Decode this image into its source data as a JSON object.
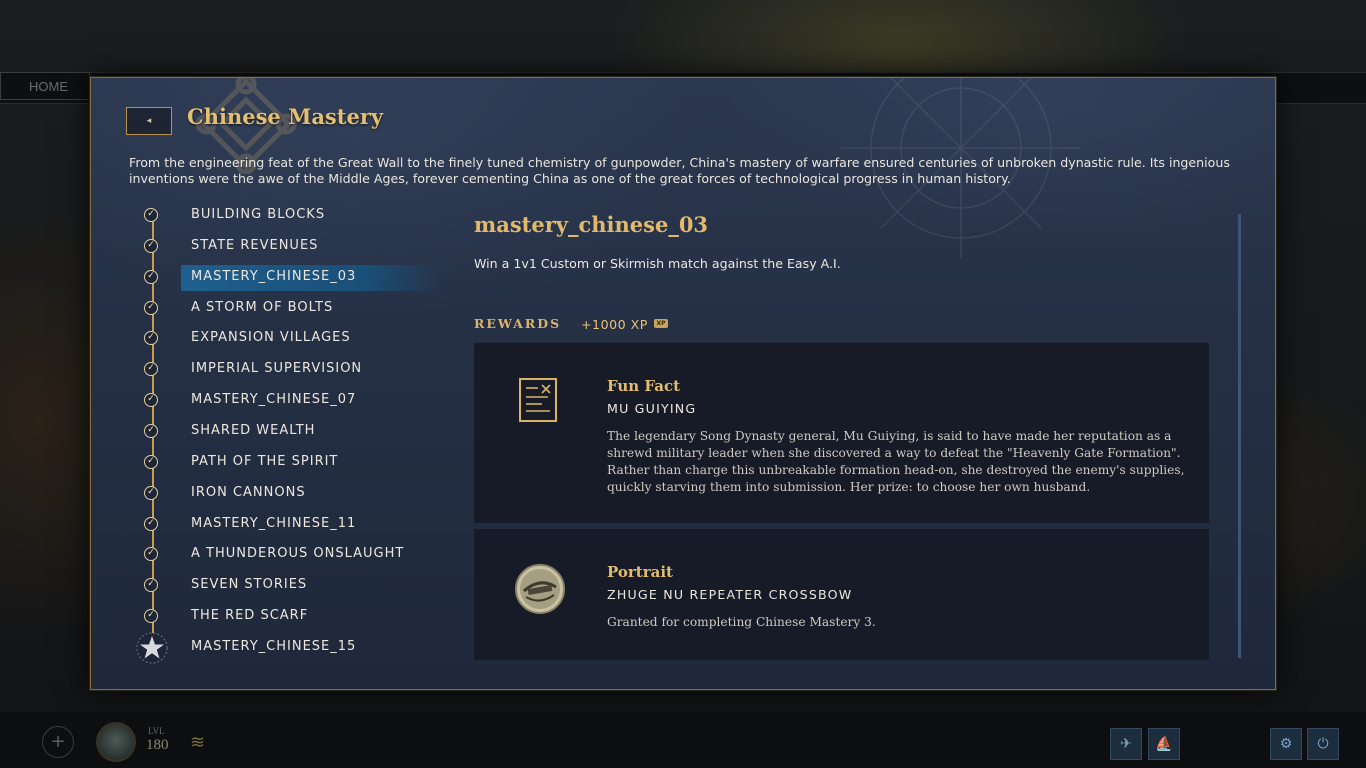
{
  "background": {
    "home_button": "HOME",
    "player_level_label": "LVL",
    "player_level": "180",
    "add_icon": "plus-icon",
    "wifi_icon": "wifi-icon",
    "power_icon": "power-icon",
    "settings_icon": "gear-icon"
  },
  "modal": {
    "title": "Chinese Mastery",
    "back_icon": "caret-left-icon",
    "back_glyph": "◂",
    "description": "From the engineering feat of the Great Wall to the finely tuned chemistry of gunpowder, China's mastery of warfare ensured centuries of unbroken dynastic rule. Its ingenious inventions were the awe of the Middle Ages, forever cementing China as one of the great forces of technological progress in human history."
  },
  "mastery_list": {
    "items": [
      {
        "label": "BUILDING BLOCKS",
        "status": "complete"
      },
      {
        "label": "STATE REVENUES",
        "status": "complete"
      },
      {
        "label": "MASTERY_CHINESE_03",
        "status": "complete",
        "selected": true
      },
      {
        "label": "A STORM OF BOLTS",
        "status": "complete"
      },
      {
        "label": "EXPANSION VILLAGES",
        "status": "complete"
      },
      {
        "label": "IMPERIAL SUPERVISION",
        "status": "complete"
      },
      {
        "label": "MASTERY_CHINESE_07",
        "status": "complete"
      },
      {
        "label": "SHARED WEALTH",
        "status": "complete"
      },
      {
        "label": "PATH OF THE SPIRIT",
        "status": "complete"
      },
      {
        "label": "IRON CANNONS",
        "status": "complete"
      },
      {
        "label": "MASTERY_CHINESE_11",
        "status": "complete"
      },
      {
        "label": "A THUNDEROUS ONSLAUGHT",
        "status": "complete"
      },
      {
        "label": "SEVEN STORIES",
        "status": "complete"
      },
      {
        "label": "THE RED SCARF",
        "status": "complete"
      },
      {
        "label": "MASTERY_CHINESE_15",
        "status": "final-star"
      }
    ],
    "check_glyph": "✓"
  },
  "detail": {
    "title": "mastery_chinese_03",
    "objective": "Win a 1v1 Custom or Skirmish match against the Easy A.I.",
    "rewards_label": "REWARDS",
    "xp_reward": "+1000 XP",
    "xp_icon_text": "XP",
    "cards": [
      {
        "type": "Fun Fact",
        "name": "MU GUIYING",
        "icon": "scroll-document-icon",
        "body": "The legendary Song Dynasty general, Mu Guiying, is said to have made her reputation as a shrewd military leader when she discovered a way to defeat the \"Heavenly Gate Formation\". Rather than charge this unbreakable formation head-on, she destroyed the enemy's supplies, quickly starving them into submission. Her prize: to choose her own husband."
      },
      {
        "type": "Portrait",
        "name": "ZHUGE NU REPEATER CROSSBOW",
        "icon": "crossbow-portrait-icon",
        "body": "Granted for completing Chinese Mastery 3."
      }
    ]
  },
  "colors": {
    "gold": "#e2b86b",
    "selected_row": "#1f5f8f",
    "panel": "#253045",
    "card": "#171b28"
  }
}
